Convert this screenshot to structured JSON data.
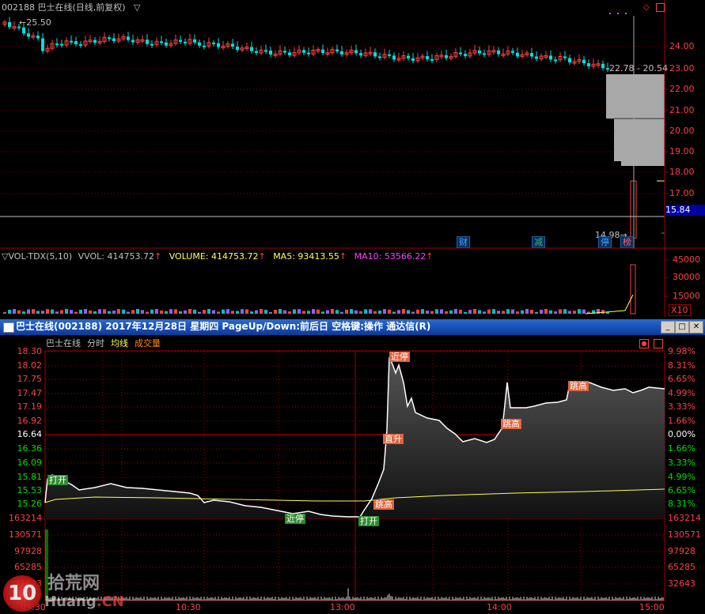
{
  "daily": {
    "header": "002188 巴士在线(日线,前复权)",
    "high_marker": "25.50",
    "low_marker": "14.98",
    "range_label": "22.78 - 20.54",
    "current_price": "15.84",
    "price_ticks": [
      "24.00",
      "23.00",
      "22.00",
      "21.00",
      "20.00",
      "19.00",
      "18.00",
      "17.00"
    ],
    "event_tags": [
      {
        "text": "财",
        "color": "#4aa3ff"
      },
      {
        "text": "减",
        "color": "#3cb371"
      },
      {
        "text": "停",
        "color": "#4aa3ff"
      },
      {
        "text": "榜",
        "color": "#ff6060"
      }
    ]
  },
  "volume": {
    "title": "VOL-TDX(5,10)",
    "vvol": "VVOL: 414753.72",
    "volume": "VOLUME: 414753.72",
    "ma5": "MA5: 93413.55",
    "ma10": "MA10: 53566.22",
    "ticks": [
      "45000",
      "30000",
      "15000"
    ],
    "unit": "X10"
  },
  "window": {
    "title": "巴士在线(002188) 2017年12月28日 星期四 PageUp/Down:前后日 空格键:操作 通达信(R)"
  },
  "intraday": {
    "tabs": [
      {
        "label": "巴士在线",
        "color": "#c0c0c0"
      },
      {
        "label": "分时",
        "color": "#c0c0c0"
      },
      {
        "label": "均线",
        "color": "#ffff55"
      },
      {
        "label": "成交量",
        "color": "#ff8800"
      }
    ],
    "left_ticks": [
      {
        "v": "18.30",
        "c": "#ff4040"
      },
      {
        "v": "18.02",
        "c": "#ff4040"
      },
      {
        "v": "17.75",
        "c": "#ff4040"
      },
      {
        "v": "17.47",
        "c": "#ff4040"
      },
      {
        "v": "17.19",
        "c": "#ff4040"
      },
      {
        "v": "16.92",
        "c": "#ff4040"
      },
      {
        "v": "16.64",
        "c": "#ffffff"
      },
      {
        "v": "16.36",
        "c": "#00e000"
      },
      {
        "v": "16.09",
        "c": "#00e000"
      },
      {
        "v": "15.81",
        "c": "#00e000"
      },
      {
        "v": "15.53",
        "c": "#00e000"
      },
      {
        "v": "15.26",
        "c": "#00e000"
      }
    ],
    "right_ticks": [
      {
        "v": "9.98%",
        "c": "#ff4040"
      },
      {
        "v": "8.31%",
        "c": "#ff4040"
      },
      {
        "v": "6.65%",
        "c": "#ff4040"
      },
      {
        "v": "4.99%",
        "c": "#ff4040"
      },
      {
        "v": "3.33%",
        "c": "#ff4040"
      },
      {
        "v": "1.66%",
        "c": "#ff4040"
      },
      {
        "v": "0.00%",
        "c": "#ffffff"
      },
      {
        "v": "1.66%",
        "c": "#00e000"
      },
      {
        "v": "3.33%",
        "c": "#00e000"
      },
      {
        "v": "4.99%",
        "c": "#00e000"
      },
      {
        "v": "6.65%",
        "c": "#00e000"
      },
      {
        "v": "8.31%",
        "c": "#00e000"
      }
    ],
    "vol_ticks": [
      "163214",
      "130571",
      "97928",
      "65285",
      "32643"
    ],
    "time_ticks": [
      "09:30",
      "10:30",
      "13:00",
      "14:00",
      "15:00"
    ],
    "annotations": [
      {
        "text": "打开",
        "bg": "#2e8b2e"
      },
      {
        "text": "近停",
        "bg": "#2e8b2e"
      },
      {
        "text": "打开",
        "bg": "#2e8b2e"
      },
      {
        "text": "跳高",
        "bg": "#e0643c"
      },
      {
        "text": "直升",
        "bg": "#e0643c"
      },
      {
        "text": "近停",
        "bg": "#e0643c"
      },
      {
        "text": "跳高",
        "bg": "#e0643c"
      },
      {
        "text": "跳高",
        "bg": "#e0643c"
      }
    ]
  },
  "watermark": {
    "brand": "拾荒网",
    "domain": "Huang",
    "suffix": ".CN",
    "logo_num": "10"
  }
}
